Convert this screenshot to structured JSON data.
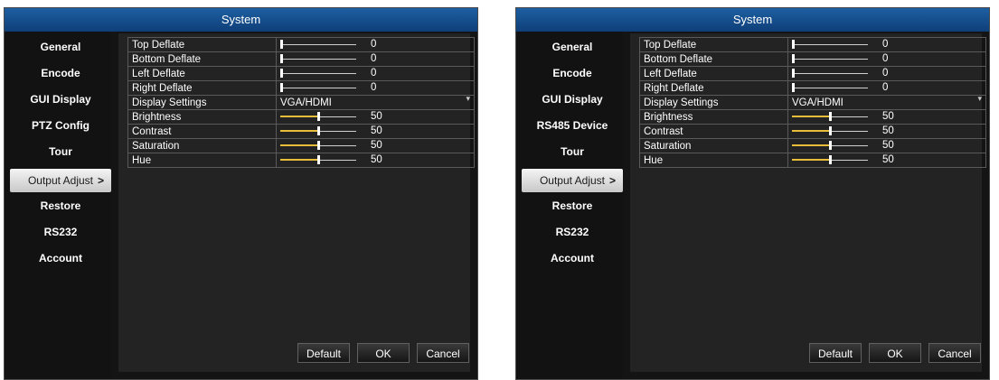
{
  "panels": [
    {
      "title": "System",
      "sidebar": [
        {
          "label": "General"
        },
        {
          "label": "Encode"
        },
        {
          "label": "GUI Display"
        },
        {
          "label": "PTZ Config"
        },
        {
          "label": "Tour"
        },
        {
          "label": "Output Adjust",
          "active": true,
          "chevron": ">"
        },
        {
          "label": "Restore"
        },
        {
          "label": "RS232"
        },
        {
          "label": "Account"
        }
      ],
      "settings": [
        {
          "label": "Top Deflate",
          "value": "0",
          "level": 0
        },
        {
          "label": "Bottom Deflate",
          "value": "0",
          "level": 0
        },
        {
          "label": "Left Deflate",
          "value": "0",
          "level": 0
        },
        {
          "label": "Right Deflate",
          "value": "0",
          "level": 0
        },
        {
          "label": "Display Settings",
          "value": "VGA/HDMI",
          "dropdown": true
        },
        {
          "label": "Brightness",
          "value": "50",
          "level": 50
        },
        {
          "label": "Contrast",
          "value": "50",
          "level": 50
        },
        {
          "label": "Saturation",
          "value": "50",
          "level": 50
        },
        {
          "label": "Hue",
          "value": "50",
          "level": 50
        }
      ],
      "buttons": {
        "default": "Default",
        "ok": "OK",
        "cancel": "Cancel"
      }
    },
    {
      "title": "System",
      "sidebar": [
        {
          "label": "General"
        },
        {
          "label": "Encode"
        },
        {
          "label": "GUI Display"
        },
        {
          "label": "RS485 Device"
        },
        {
          "label": "Tour"
        },
        {
          "label": "Output Adjust",
          "active": true,
          "chevron": ">"
        },
        {
          "label": "Restore"
        },
        {
          "label": "RS232"
        },
        {
          "label": "Account"
        }
      ],
      "settings": [
        {
          "label": "Top Deflate",
          "value": "0",
          "level": 0
        },
        {
          "label": "Bottom Deflate",
          "value": "0",
          "level": 0
        },
        {
          "label": "Left Deflate",
          "value": "0",
          "level": 0
        },
        {
          "label": "Right Deflate",
          "value": "0",
          "level": 0
        },
        {
          "label": "Display Settings",
          "value": "VGA/HDMI",
          "dropdown": true
        },
        {
          "label": "Brightness",
          "value": "50",
          "level": 50
        },
        {
          "label": "Contrast",
          "value": "50",
          "level": 50
        },
        {
          "label": "Saturation",
          "value": "50",
          "level": 50
        },
        {
          "label": "Hue",
          "value": "50",
          "level": 50
        }
      ],
      "buttons": {
        "default": "Default",
        "ok": "OK",
        "cancel": "Cancel"
      }
    }
  ],
  "colors": {
    "titlebar": "#1d5fa2",
    "slider_fill": "#e7bd3a",
    "background": "#141414"
  }
}
